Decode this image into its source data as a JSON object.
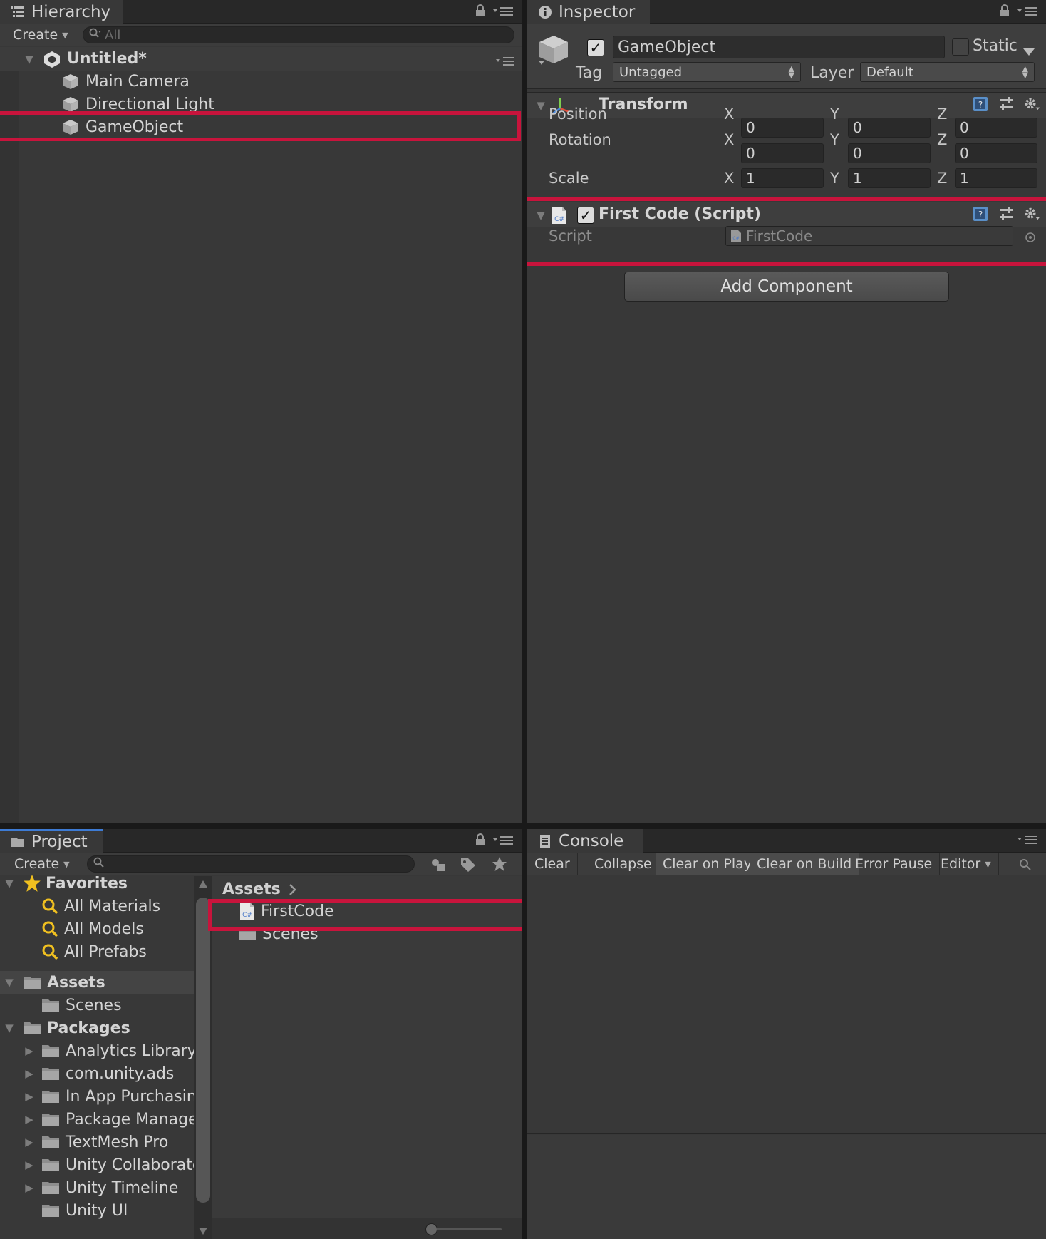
{
  "hierarchy": {
    "tab_label": "Hierarchy",
    "create_label": "Create",
    "search_placeholder": "All",
    "scene_name": "Untitled*",
    "items": [
      "Main Camera",
      "Directional Light",
      "GameObject"
    ],
    "selected_item": "GameObject"
  },
  "inspector": {
    "tab_label": "Inspector",
    "object_name": "GameObject",
    "active": true,
    "static_label": "Static",
    "tag_label": "Tag",
    "tag_value": "Untagged",
    "layer_label": "Layer",
    "layer_value": "Default",
    "transform": {
      "title": "Transform",
      "rows": [
        {
          "label": "Position",
          "x": "0",
          "y": "0",
          "z": "0"
        },
        {
          "label": "Rotation",
          "x": "0",
          "y": "0",
          "z": "0"
        },
        {
          "label": "Scale",
          "x": "1",
          "y": "1",
          "z": "1"
        }
      ],
      "axis_labels": [
        "X",
        "Y",
        "Z"
      ]
    },
    "script_component": {
      "title": "First Code (Script)",
      "enabled": true,
      "field_label": "Script",
      "field_value": "FirstCode"
    },
    "add_component_label": "Add Component"
  },
  "project": {
    "tab_label": "Project",
    "create_label": "Create",
    "favorites_label": "Favorites",
    "favorites": [
      "All Materials",
      "All Models",
      "All Prefabs"
    ],
    "assets_label": "Assets",
    "assets_children": [
      "Scenes"
    ],
    "packages_label": "Packages",
    "packages": [
      "Analytics Library",
      "com.unity.ads",
      "In App Purchasin",
      "Package Manage",
      "TextMesh Pro",
      "Unity Collaborate",
      "Unity Timeline",
      "Unity UI"
    ],
    "breadcrumb": "Assets",
    "files": [
      "FirstCode",
      "Scenes"
    ]
  },
  "console": {
    "tab_label": "Console",
    "buttons": [
      "Clear",
      "Collapse",
      "Clear on Play",
      "Clear on Build",
      "Error Pause",
      "Editor"
    ]
  },
  "colors": {
    "highlight": "#c8143c",
    "panel_bg": "#383838",
    "accent_tab": "#3d7bd4"
  }
}
